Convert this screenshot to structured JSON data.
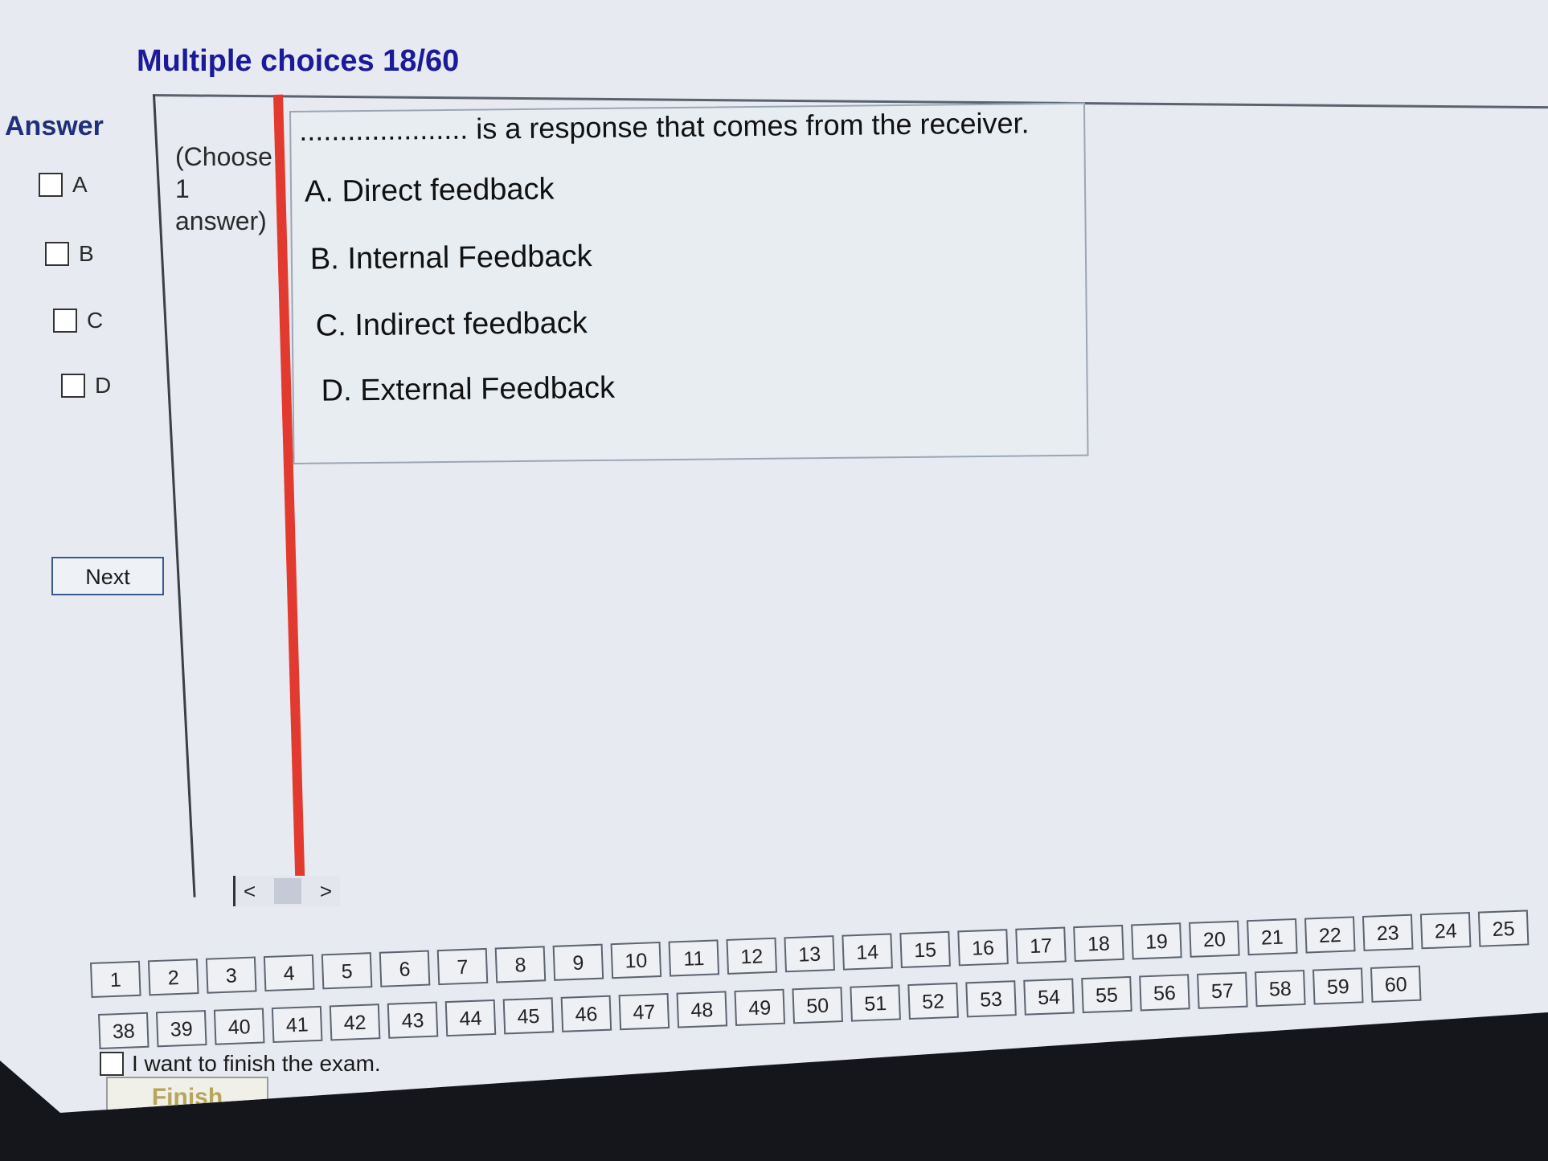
{
  "header": {
    "title": "Multiple choices 18/60"
  },
  "answer_panel": {
    "label": "Answer",
    "options": [
      "A",
      "B",
      "C",
      "D"
    ],
    "next_label": "Next"
  },
  "instruction": {
    "line1": "(Choose",
    "line2": "1",
    "line3": "answer)"
  },
  "question": {
    "text": "..................... is a response that comes from the receiver.",
    "choices": [
      "A. Direct feedback",
      "B. Internal Feedback",
      "C. Indirect feedback",
      "D. External Feedback"
    ]
  },
  "scroll": {
    "left_arrow": "<",
    "right_arrow": ">"
  },
  "pagination": {
    "row1": [
      "1",
      "2",
      "3",
      "4",
      "5",
      "6",
      "7",
      "8",
      "9",
      "10",
      "11",
      "12",
      "13",
      "14",
      "15",
      "16",
      "17",
      "18",
      "19",
      "20",
      "21",
      "22",
      "23",
      "24",
      "25"
    ],
    "row2": [
      "38",
      "39",
      "40",
      "41",
      "42",
      "43",
      "44",
      "45",
      "46",
      "47",
      "48",
      "49",
      "50",
      "51",
      "52",
      "53",
      "54",
      "55",
      "56",
      "57",
      "58",
      "59",
      "60"
    ]
  },
  "footer": {
    "finish_checkbox_label": "I want to finish the exam.",
    "finish_button": "Finish"
  }
}
